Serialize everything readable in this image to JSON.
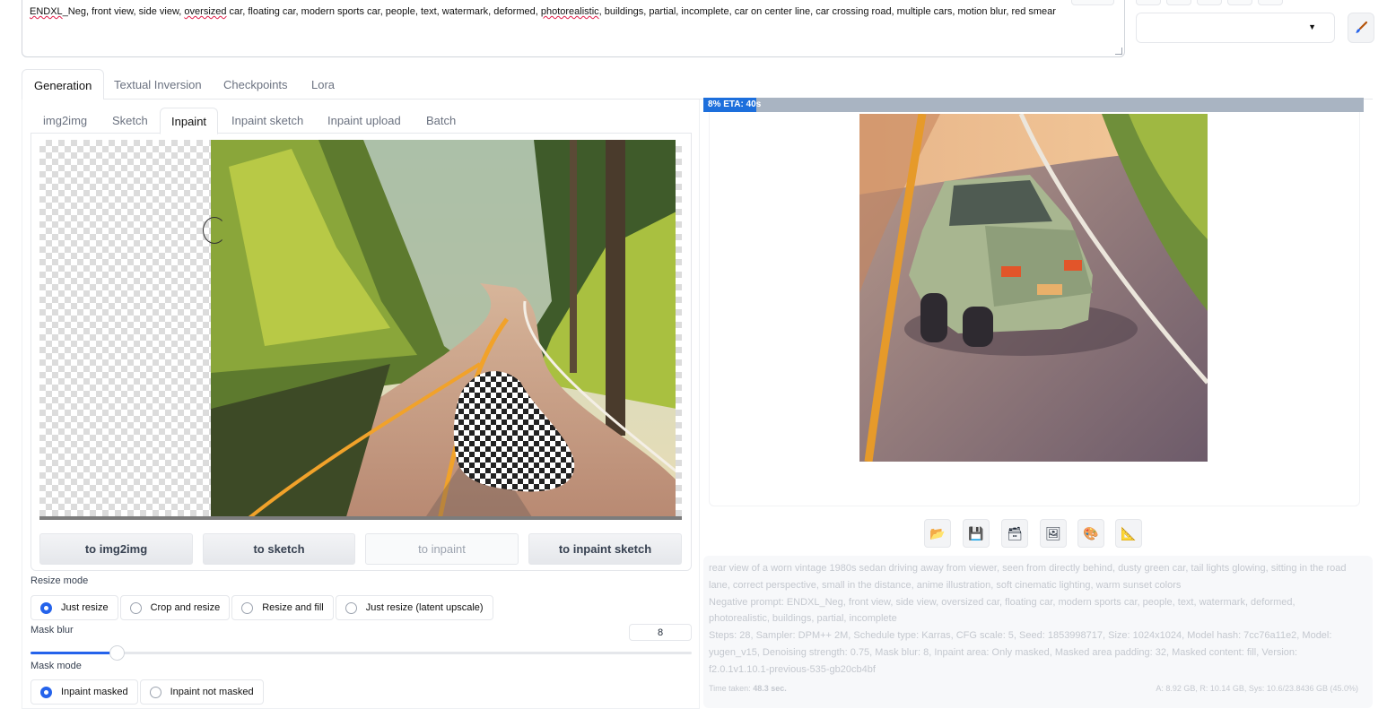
{
  "prompt": {
    "negative_text_parts": [
      "ENDXL",
      "_Neg, front view, side view, ",
      "oversized",
      " car, floating car, modern sports car, people, text, watermark, deformed, ",
      "photorealistic",
      ", buildings, partial, incomplete, car on center line, car crossing road, multiple cars, motion blur, red smear"
    ]
  },
  "main_tabs": [
    "Generation",
    "Textual Inversion",
    "Checkpoints",
    "Lora"
  ],
  "sub_tabs": [
    "img2img",
    "Sketch",
    "Inpaint",
    "Inpaint sketch",
    "Inpaint upload",
    "Batch"
  ],
  "transfer_buttons": [
    "to img2img",
    "to sketch",
    "to inpaint",
    "to inpaint sketch"
  ],
  "resize_mode": {
    "label": "Resize mode",
    "options": [
      "Just resize",
      "Crop and resize",
      "Resize and fill",
      "Just resize (latent upscale)"
    ],
    "selected": "Just resize"
  },
  "mask_blur": {
    "label": "Mask blur",
    "value": "8",
    "fraction": 0.13
  },
  "mask_mode": {
    "label": "Mask mode",
    "options": [
      "Inpaint masked",
      "Inpaint not masked"
    ],
    "selected": "Inpaint masked"
  },
  "progress": {
    "text": "8% ETA: 40s",
    "fraction": 0.08
  },
  "tool_icons": [
    "folder-icon",
    "save-icon",
    "zip-icon",
    "image-icon",
    "palette-icon",
    "ruler-icon"
  ],
  "info": {
    "prompt": "rear view of a worn vintage 1980s sedan driving away from viewer, seen from directly behind, dusty green car, tail lights glowing, sitting in the road lane, correct perspective, small in the distance, anime illustration, soft cinematic lighting, warm sunset colors",
    "negative": "Negative prompt: ENDXL_Neg, front view, side view, oversized car, floating car, modern sports car, people, text, watermark, deformed, photorealistic, buildings, partial, incomplete",
    "params": "Steps: 28, Sampler: DPM++ 2M, Schedule type: Karras, CFG scale: 5, Seed: 1853998717, Size: 1024x1024, Model hash: 7cc76a11e2, Model: yugen_v15, Denoising strength: 0.75, Mask blur: 8, Inpaint area: Only masked, Masked area padding: 32, Masked content: fill, Version: f2.0.1v1.10.1-previous-535-gb20cb4bf",
    "time_taken_label": "Time taken:",
    "time_taken": "48.3 sec.",
    "mem_stats": "A: 8.92 GB, R: 10.14 GB, Sys: 10.6/23.8436 GB (45.0%)"
  },
  "colors": {
    "accent": "#2563eb",
    "progress_fill": "#1d6fdc",
    "progress_track": "#a9b4c2"
  }
}
